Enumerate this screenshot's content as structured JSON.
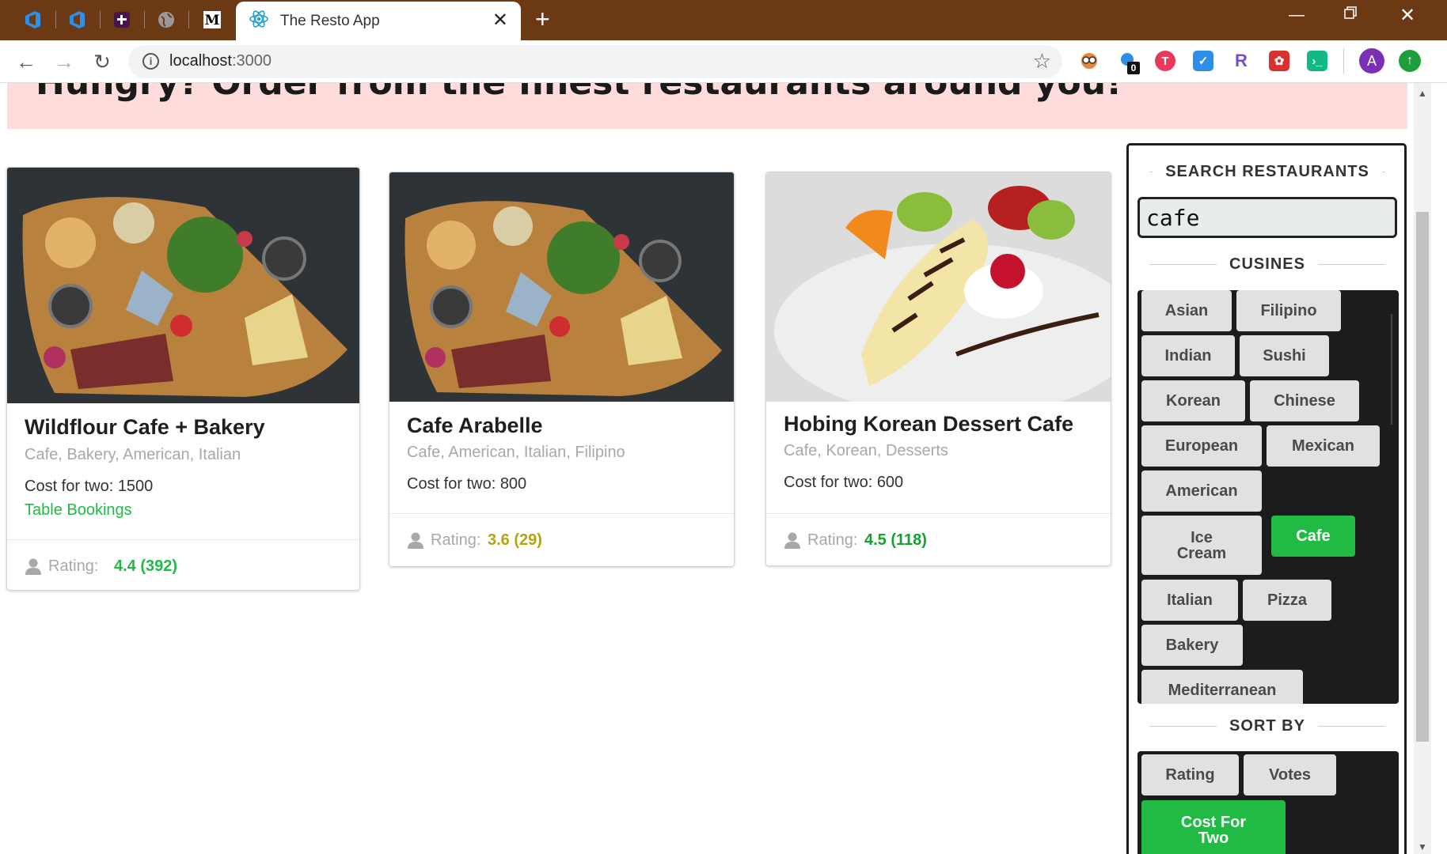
{
  "browser": {
    "tab_title": "The Resto App",
    "url_host": "localhost",
    "url_port": ":3000",
    "pinned_tabs": [
      "azure-devops-icon",
      "azure-devops-icon",
      "slack-icon",
      "globe-icon",
      "medium-icon"
    ],
    "extension_badge": "0",
    "profile_initial": "A"
  },
  "header": {
    "title": "Hungry? Order from the finest restaurants around you!"
  },
  "restaurants": [
    {
      "name": "Wildflour Cafe + Bakery",
      "cuisines": "Cafe, Bakery, American, Italian",
      "cost": "Cost for two: 1500",
      "booking": "Table Bookings",
      "rating_label": "Rating:",
      "rating": "4.4 (392)",
      "rating_color": "#21ba45"
    },
    {
      "name": "Cafe Arabelle",
      "cuisines": "Cafe, American, Italian, Filipino",
      "cost": "Cost for two: 800",
      "rating_label": "Rating:",
      "rating": "3.6 (29)",
      "rating_color": "#b5a30f"
    },
    {
      "name": "Hobing Korean Dessert Cafe",
      "cuisines": "Cafe, Korean, Desserts",
      "cost": "Cost for two: 600",
      "rating_label": "Rating:",
      "rating": "4.5 (118)",
      "rating_color": "#16a02f"
    }
  ],
  "sidebar": {
    "search_heading": "SEARCH RESTAURANTS",
    "search_value": "cafe",
    "cuisines_heading": "CUSINES",
    "cuisines": [
      "Asian",
      "Filipino",
      "Indian",
      "Sushi",
      "Korean",
      "Chinese",
      "European",
      "Mexican",
      "American",
      "Ice Cream",
      "Cafe",
      "Italian",
      "Pizza",
      "Bakery",
      "Mediterranean"
    ],
    "active_cuisine": "Cafe",
    "sort_heading": "SORT BY",
    "sort_options": [
      "Rating",
      "Votes",
      "Cost For Two"
    ],
    "active_sort": "Cost For Two"
  },
  "colors": {
    "accent": "#21ba45",
    "banner": "#ffdcdc",
    "chrome": "#6b3a14"
  }
}
